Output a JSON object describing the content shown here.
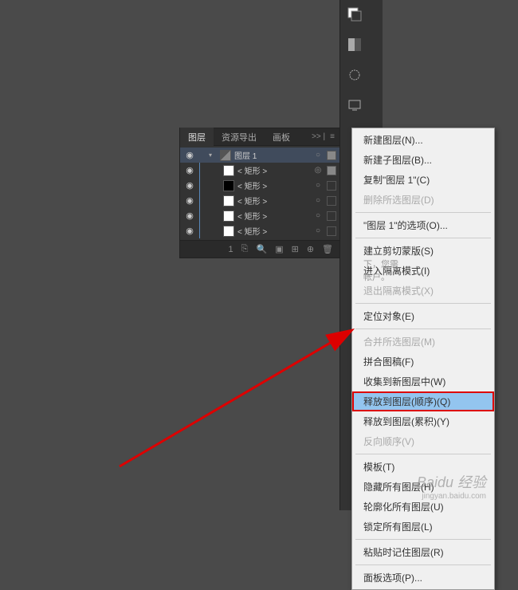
{
  "panel": {
    "tabs": [
      "图层",
      "资源导出",
      "画板"
    ],
    "menu_hint": ">> |",
    "group_name": "图层 1",
    "sublayers": [
      "< 矩形 >",
      "< 矩形 >",
      "< 矩形 >",
      "< 矩形 >",
      "< 矩形 >"
    ],
    "footer_count": "1"
  },
  "menu": {
    "items": [
      {
        "label": "新建图层(N)...",
        "enabled": true
      },
      {
        "label": "新建子图层(B)...",
        "enabled": true
      },
      {
        "label": "复制\"图层 1\"(C)",
        "enabled": true
      },
      {
        "label": "删除所选图层(D)",
        "enabled": false
      },
      {
        "sep": true
      },
      {
        "label": "\"图层 1\"的选项(O)...",
        "enabled": true
      },
      {
        "sep": true
      },
      {
        "label": "建立剪切蒙版(S)",
        "enabled": true
      },
      {
        "label": "进入隔离模式(I)",
        "enabled": true
      },
      {
        "label": "退出隔离模式(X)",
        "enabled": false
      },
      {
        "sep": true
      },
      {
        "label": "定位对象(E)",
        "enabled": true
      },
      {
        "sep": true
      },
      {
        "label": "合并所选图层(M)",
        "enabled": false
      },
      {
        "label": "拼合图稿(F)",
        "enabled": true
      },
      {
        "label": "收集到新图层中(W)",
        "enabled": true
      },
      {
        "label": "释放到图层(顺序)(Q)",
        "enabled": true,
        "highlight": true
      },
      {
        "label": "释放到图层(累积)(Y)",
        "enabled": true
      },
      {
        "label": "反向顺序(V)",
        "enabled": false
      },
      {
        "sep": true
      },
      {
        "label": "模板(T)",
        "enabled": true
      },
      {
        "label": "隐藏所有图层(H)",
        "enabled": true
      },
      {
        "label": "轮廓化所有图层(U)",
        "enabled": true
      },
      {
        "label": "锁定所有图层(L)",
        "enabled": true
      },
      {
        "sep": true
      },
      {
        "label": "粘贴时记住图层(R)",
        "enabled": true
      },
      {
        "sep": true
      },
      {
        "label": "面板选项(P)...",
        "enabled": true
      }
    ]
  },
  "side_text": {
    "l1": "下，您需",
    "l2": "帐户。"
  },
  "watermark": {
    "brand": "Baidu 经验",
    "url": "jingyan.baidu.com"
  }
}
